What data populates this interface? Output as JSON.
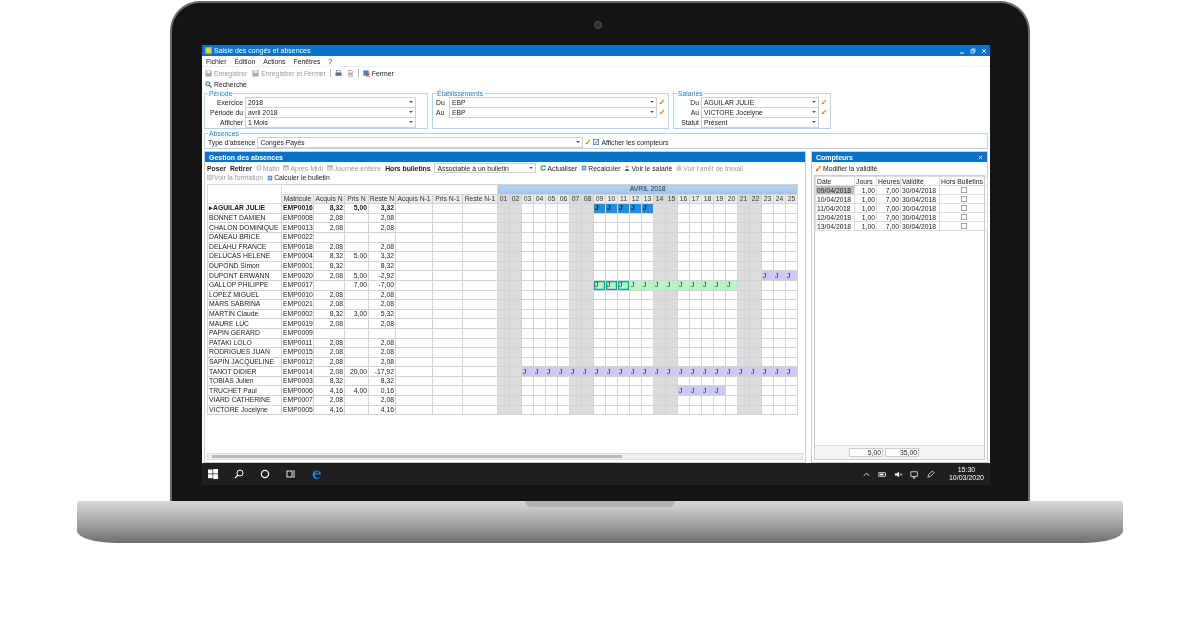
{
  "window": {
    "title": "Saisie des congés et absences"
  },
  "menu": [
    "Fichier",
    "Édition",
    "Actions",
    "Fenêtres",
    "?"
  ],
  "toolbar": [
    {
      "kind": "save",
      "label": "Enregistrer",
      "disabled": true
    },
    {
      "kind": "save-close",
      "label": "Enregistrer et Fermer",
      "disabled": true
    },
    {
      "kind": "print",
      "disabled": false
    },
    {
      "kind": "preview",
      "disabled": false
    },
    {
      "kind": "close",
      "label": "Fermer",
      "disabled": false
    }
  ],
  "search_button": "Recherche",
  "filters": [
    {
      "legend": "Période",
      "fields": [
        {
          "kind": "select",
          "label": "Exercice",
          "value": "2018"
        },
        {
          "kind": "select",
          "label": "Période du",
          "value": "avril 2018"
        },
        {
          "kind": "select",
          "label": "Afficher",
          "value": "1 Mois"
        }
      ]
    },
    {
      "legend": "Établissements",
      "fields": [
        {
          "kind": "edit",
          "label": "Du",
          "value": "EBP"
        },
        {
          "kind": "edit",
          "label": "Au",
          "value": "EBP"
        }
      ]
    },
    {
      "legend": "Salariés",
      "fields": [
        {
          "kind": "edit",
          "label": "Du",
          "value": "AGUILAR JULIE"
        },
        {
          "kind": "edit",
          "label": "Au",
          "value": "VICTORE Jocelyne"
        },
        {
          "kind": "select",
          "label": "Statut",
          "value": "Présent"
        }
      ]
    }
  ],
  "absences": {
    "legend": "Absences",
    "label": "Type d'absence",
    "value": "Congés Payés",
    "show_counters": {
      "label": "Afficher les compteurs",
      "checked": true
    }
  },
  "gestion": {
    "title": "Gestion des absences",
    "tools": [
      {
        "kind": "text",
        "label": "Poser",
        "disabled": false
      },
      {
        "kind": "text",
        "label": "Retirer",
        "disabled": false
      },
      {
        "kind": "radio",
        "label": "Matin",
        "disabled": true
      },
      {
        "kind": "half",
        "label": "Après-Midi",
        "disabled": true
      },
      {
        "kind": "day",
        "label": "Journée entière",
        "disabled": true
      }
    ],
    "hors_bulletins": {
      "label": "Hors bulletins",
      "value": "Associable à un bulletin"
    },
    "actions": [
      {
        "kind": "refresh",
        "label": "Actualiser",
        "disabled": false
      },
      {
        "kind": "calc",
        "label": "Recalculer",
        "disabled": false
      },
      {
        "kind": "person",
        "label": "Voir le salarié",
        "disabled": false
      },
      {
        "kind": "case",
        "label": "Voir l'arrêt de travail",
        "disabled": true
      },
      {
        "kind": "board",
        "label": "Voir la formation",
        "disabled": true
      },
      {
        "kind": "calc",
        "label": "Calculer le bulletin",
        "disabled": false
      }
    ],
    "columns": [
      "Matricule",
      "Acquis N",
      "Pris N",
      "Reste N",
      "Acquis N-1",
      "Pris N-1",
      "Reste N-1"
    ],
    "month": "AVRIL 2018",
    "row_marker": "▸",
    "days": [
      {
        "label": "01",
        "off": true
      },
      {
        "label": "02",
        "off": true
      },
      {
        "label": "03",
        "off": false
      },
      {
        "label": "04",
        "off": false
      },
      {
        "label": "05",
        "off": false
      },
      {
        "label": "06",
        "off": false
      },
      {
        "label": "07",
        "off": true
      },
      {
        "label": "08",
        "off": true
      },
      {
        "label": "09",
        "off": false
      },
      {
        "label": "10",
        "off": false
      },
      {
        "label": "11",
        "off": false
      },
      {
        "label": "12",
        "off": false
      },
      {
        "label": "13",
        "off": false
      },
      {
        "label": "14",
        "off": true
      },
      {
        "label": "15",
        "off": true
      },
      {
        "label": "16",
        "off": false
      },
      {
        "label": "17",
        "off": false
      },
      {
        "label": "18",
        "off": false
      },
      {
        "label": "19",
        "off": false
      },
      {
        "label": "20",
        "off": false
      },
      {
        "label": "21",
        "off": true
      },
      {
        "label": "22",
        "off": true
      },
      {
        "label": "23",
        "off": false
      },
      {
        "label": "24",
        "off": false
      },
      {
        "label": "25",
        "off": false
      }
    ],
    "rows": [
      {
        "name": "AGUILAR JULIE",
        "selected": true,
        "matricule": "EMP0016",
        "acquis_n": "8,32",
        "pris_n": "5,00",
        "reste_n": "3,32",
        "days": [
          {
            "absent": false
          },
          {
            "absent": false
          },
          {
            "absent": false
          },
          {
            "absent": false
          },
          {
            "absent": false
          },
          {
            "absent": false
          },
          {
            "absent": false
          },
          {
            "absent": false
          },
          {
            "absent": true,
            "text": "J",
            "color": "#1e8fe6",
            "selected": false
          },
          {
            "absent": true,
            "text": "J",
            "color": "#1e8fe6",
            "selected": false
          },
          {
            "absent": true,
            "text": "J",
            "color": "#1e8fe6",
            "selected": false
          },
          {
            "absent": true,
            "text": "J",
            "color": "#1e8fe6",
            "selected": false
          },
          {
            "absent": true,
            "text": "J",
            "color": "#1e8fe6",
            "selected": false
          },
          {
            "absent": false
          },
          {
            "absent": false
          },
          {
            "absent": false
          },
          {
            "absent": false
          },
          {
            "absent": false
          },
          {
            "absent": false
          },
          {
            "absent": false
          },
          {
            "absent": false
          },
          {
            "absent": false
          },
          {
            "absent": false
          },
          {
            "absent": false
          },
          {
            "absent": false
          }
        ]
      },
      {
        "name": "BONNET DAMIEN",
        "selected": false,
        "matricule": "EMP0008",
        "acquis_n": "2,08",
        "reste_n": "2,08"
      },
      {
        "name": "CHALON DOMINIQUE",
        "selected": false,
        "matricule": "EMP0013",
        "acquis_n": "2,08",
        "reste_n": "2,08"
      },
      {
        "name": "DANEAU BRICE",
        "selected": false,
        "matricule": "EMP0022"
      },
      {
        "name": "DELAHU FRANCE",
        "selected": false,
        "matricule": "EMP0018",
        "acquis_n": "2,08",
        "reste_n": "2,08"
      },
      {
        "name": "DELUCAS HELENE",
        "selected": false,
        "matricule": "EMP0004",
        "acquis_n": "8,32",
        "pris_n": "5,00",
        "reste_n": "3,32"
      },
      {
        "name": "DUPOND Simon",
        "selected": false,
        "matricule": "EMP0001",
        "acquis_n": "8,32",
        "reste_n": "8,32"
      },
      {
        "name": "DUPONT ERWANN",
        "selected": false,
        "matricule": "EMP0020",
        "acquis_n": "2,08",
        "pris_n": "5,00",
        "reste_n": "-2,92",
        "days": [
          {
            "absent": false
          },
          {
            "absent": false
          },
          {
            "absent": false
          },
          {
            "absent": false
          },
          {
            "absent": false
          },
          {
            "absent": false
          },
          {
            "absent": false
          },
          {
            "absent": false
          },
          {
            "absent": false
          },
          {
            "absent": false
          },
          {
            "absent": false
          },
          {
            "absent": false
          },
          {
            "absent": false
          },
          {
            "absent": false
          },
          {
            "absent": false
          },
          {
            "absent": false
          },
          {
            "absent": false
          },
          {
            "absent": false
          },
          {
            "absent": false
          },
          {
            "absent": false
          },
          {
            "absent": false
          },
          {
            "absent": false
          },
          {
            "absent": true,
            "text": "J",
            "color": "#c9c9fa",
            "selected": false
          },
          {
            "absent": true,
            "text": "J",
            "color": "#c9c9fa",
            "selected": false
          },
          {
            "absent": true,
            "text": "J",
            "color": "#c9c9fa",
            "selected": false
          }
        ]
      },
      {
        "name": "GALLOP PHILIPPE",
        "selected": false,
        "matricule": "EMP0017",
        "pris_n": "7,00",
        "reste_n": "-7,00",
        "days": [
          {
            "absent": false
          },
          {
            "absent": false
          },
          {
            "absent": false
          },
          {
            "absent": false
          },
          {
            "absent": false
          },
          {
            "absent": false
          },
          {
            "absent": false
          },
          {
            "absent": false
          },
          {
            "absent": true,
            "text": "J",
            "color": "#b6f5c6",
            "selected": true
          },
          {
            "absent": true,
            "text": "J",
            "color": "#b6f5c6",
            "selected": true
          },
          {
            "absent": true,
            "text": "J",
            "color": "#b6f5c6",
            "selected": true
          },
          {
            "absent": true,
            "text": "J",
            "color": "#b6f5c6",
            "selected": false
          },
          {
            "absent": true,
            "text": "J",
            "color": "#b6f5c6",
            "selected": false
          },
          {
            "absent": true,
            "text": "J",
            "color": "#b6f5c6",
            "selected": false
          },
          {
            "absent": true,
            "text": "J",
            "color": "#b6f5c6",
            "selected": false
          },
          {
            "absent": true,
            "text": "J",
            "color": "#b6f5c6",
            "selected": false
          },
          {
            "absent": true,
            "text": "J",
            "color": "#b6f5c6",
            "selected": false
          },
          {
            "absent": true,
            "text": "J",
            "color": "#b6f5c6",
            "selected": false
          },
          {
            "absent": true,
            "text": "J",
            "color": "#b6f5c6",
            "selected": false
          },
          {
            "absent": true,
            "text": "J",
            "color": "#b6f5c6",
            "selected": false
          },
          {
            "absent": false
          },
          {
            "absent": false
          },
          {
            "absent": false
          },
          {
            "absent": false
          },
          {
            "absent": false
          }
        ]
      },
      {
        "name": "LOPEZ MIGUEL",
        "selected": false,
        "matricule": "EMP0010",
        "acquis_n": "2,08",
        "reste_n": "2,08"
      },
      {
        "name": "MARS SABRINA",
        "selected": false,
        "matricule": "EMP0021",
        "acquis_n": "2,08",
        "reste_n": "2,08"
      },
      {
        "name": "MARTIN Claude",
        "selected": false,
        "matricule": "EMP0002",
        "acquis_n": "8,32",
        "pris_n": "3,00",
        "reste_n": "5,32"
      },
      {
        "name": "MAURE LUC",
        "selected": false,
        "matricule": "EMP0019",
        "acquis_n": "2,08",
        "reste_n": "2,08"
      },
      {
        "name": "PAPIN GERARD",
        "selected": false,
        "matricule": "EMP0009"
      },
      {
        "name": "PATAKI LOLO",
        "selected": false,
        "matricule": "EMP0011",
        "acquis_n": "2,08",
        "reste_n": "2,08"
      },
      {
        "name": "RODRIGUES JUAN",
        "selected": false,
        "matricule": "EMP0015",
        "acquis_n": "2,08",
        "reste_n": "2,08"
      },
      {
        "name": "SAPIN JACQUELINE",
        "selected": false,
        "matricule": "EMP0012",
        "acquis_n": "2,08",
        "reste_n": "2,08"
      },
      {
        "name": "TANOT DIDIER",
        "selected": false,
        "matricule": "EMP0014",
        "acquis_n": "2,08",
        "pris_n": "20,00",
        "reste_n": "-17,92",
        "days": [
          {
            "absent": false
          },
          {
            "absent": false
          },
          {
            "absent": true,
            "text": "J",
            "color": "#c9c9fa",
            "selected": false
          },
          {
            "absent": true,
            "text": "J",
            "color": "#c9c9fa",
            "selected": false
          },
          {
            "absent": true,
            "text": "J",
            "color": "#c9c9fa",
            "selected": false
          },
          {
            "absent": true,
            "text": "J",
            "color": "#c9c9fa",
            "selected": false
          },
          {
            "absent": true,
            "text": "J",
            "color": "#c9c9fa",
            "selected": false
          },
          {
            "absent": true,
            "text": "J",
            "color": "#c9c9fa",
            "selected": false
          },
          {
            "absent": true,
            "text": "J",
            "color": "#c9c9fa",
            "selected": false
          },
          {
            "absent": true,
            "text": "J",
            "color": "#c9c9fa",
            "selected": false
          },
          {
            "absent": true,
            "text": "J",
            "color": "#c9c9fa",
            "selected": false
          },
          {
            "absent": true,
            "text": "J",
            "color": "#c9c9fa",
            "selected": false
          },
          {
            "absent": true,
            "text": "J",
            "color": "#c9c9fa",
            "selected": false
          },
          {
            "absent": true,
            "text": "J",
            "color": "#c9c9fa",
            "selected": false
          },
          {
            "absent": true,
            "text": "J",
            "color": "#c9c9fa",
            "selected": false
          },
          {
            "absent": true,
            "text": "J",
            "color": "#c9c9fa",
            "selected": false
          },
          {
            "absent": true,
            "text": "J",
            "color": "#c9c9fa",
            "selected": false
          },
          {
            "absent": true,
            "text": "J",
            "color": "#c9c9fa",
            "selected": false
          },
          {
            "absent": true,
            "text": "J",
            "color": "#c9c9fa",
            "selected": false
          },
          {
            "absent": true,
            "text": "J",
            "color": "#c9c9fa",
            "selected": false
          },
          {
            "absent": true,
            "text": "J",
            "color": "#c9c9fa",
            "selected": false
          },
          {
            "absent": true,
            "text": "J",
            "color": "#c9c9fa",
            "selected": false
          },
          {
            "absent": true,
            "text": "J",
            "color": "#c9c9fa",
            "selected": false
          },
          {
            "absent": true,
            "text": "J",
            "color": "#c9c9fa",
            "selected": false
          },
          {
            "absent": true,
            "text": "J",
            "color": "#c9c9fa",
            "selected": false
          }
        ]
      },
      {
        "name": "TOBIAS Julien",
        "selected": false,
        "matricule": "EMP0003",
        "acquis_n": "8,32",
        "reste_n": "8,32"
      },
      {
        "name": "TRUCHET Paul",
        "selected": false,
        "matricule": "EMP0006",
        "acquis_n": "4,16",
        "pris_n": "4,00",
        "reste_n": "0,16",
        "days": [
          {
            "absent": false
          },
          {
            "absent": false
          },
          {
            "absent": false
          },
          {
            "absent": false
          },
          {
            "absent": false
          },
          {
            "absent": false
          },
          {
            "absent": false
          },
          {
            "absent": false
          },
          {
            "absent": false
          },
          {
            "absent": false
          },
          {
            "absent": false
          },
          {
            "absent": false
          },
          {
            "absent": false
          },
          {
            "absent": false
          },
          {
            "absent": false
          },
          {
            "absent": true,
            "text": "J",
            "color": "#c9c9fa",
            "selected": false
          },
          {
            "absent": true,
            "text": "J",
            "color": "#c9c9fa",
            "selected": false
          },
          {
            "absent": true,
            "text": "J",
            "color": "#c9c9fa",
            "selected": false
          },
          {
            "absent": true,
            "text": "J",
            "color": "#c9c9fa",
            "selected": false
          },
          {
            "absent": false
          },
          {
            "absent": false
          },
          {
            "absent": false
          },
          {
            "absent": false
          },
          {
            "absent": false
          },
          {
            "absent": false
          }
        ]
      },
      {
        "name": "VIARD CATHERINE",
        "selected": false,
        "matricule": "EMP0007",
        "acquis_n": "2,08",
        "reste_n": "2,08"
      },
      {
        "name": "VICTORE Jocelyne",
        "selected": false,
        "matricule": "EMP0005",
        "acquis_n": "4,16",
        "reste_n": "4,16"
      }
    ]
  },
  "compteurs": {
    "title": "Compteurs",
    "action": "Modifier la validité",
    "columns": [
      "Date",
      "Jours",
      "Heures",
      "Validité",
      "Hors Bulletins"
    ],
    "rows": [
      {
        "date": "09/04/2018",
        "jours": "1,00",
        "heures": "7,00",
        "validite": "30/04/2018",
        "selected": true,
        "hors_bulletins": false
      },
      {
        "date": "10/04/2018",
        "jours": "1,00",
        "heures": "7,00",
        "validite": "30/04/2018",
        "selected": false,
        "hors_bulletins": false
      },
      {
        "date": "11/04/2018",
        "jours": "1,00",
        "heures": "7,00",
        "validite": "30/04/2018",
        "selected": false,
        "hors_bulletins": false
      },
      {
        "date": "12/04/2018",
        "jours": "1,00",
        "heures": "7,00",
        "validite": "30/04/2018",
        "selected": false,
        "hors_bulletins": false
      },
      {
        "date": "13/04/2018",
        "jours": "1,00",
        "heures": "7,00",
        "validite": "30/04/2018",
        "selected": false,
        "hors_bulletins": false
      }
    ],
    "totals": [
      "5,00",
      "35,00"
    ]
  },
  "taskbar": {
    "time": "15:30",
    "date": "10/03/2020"
  }
}
